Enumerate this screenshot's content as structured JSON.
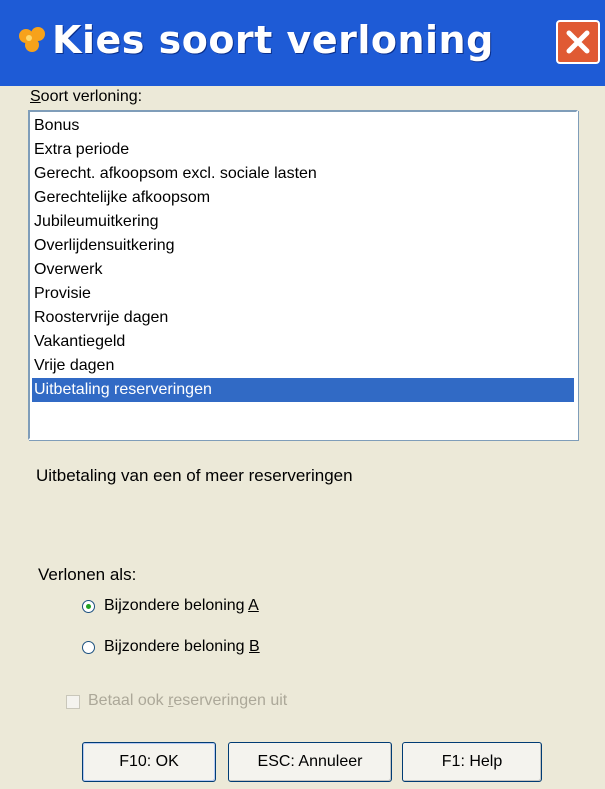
{
  "window": {
    "title": "Kies soort verloning"
  },
  "list": {
    "label_prefix": "S",
    "label_rest": "oort verloning:",
    "items": [
      "Bonus",
      "Extra periode",
      "Gerecht. afkoopsom excl. sociale lasten",
      "Gerechtelijke afkoopsom",
      "Jubileumuitkering",
      "Overlijdensuitkering",
      "Overwerk",
      "Provisie",
      "Roostervrije dagen",
      "Vakantiegeld",
      "Vrije dagen",
      "Uitbetaling reserveringen"
    ],
    "selected_index": 11
  },
  "description": "Uitbetaling van een of meer reserveringen",
  "verlonen": {
    "label": "Verlonen als:",
    "options": [
      {
        "text": "Bijzondere beloning ",
        "accel": "A",
        "checked": true
      },
      {
        "text": "Bijzondere beloning ",
        "accel": "B",
        "checked": false
      }
    ]
  },
  "checkbox": {
    "pre": "Betaal ook ",
    "accel": "r",
    "post": "eserveringen uit",
    "checked": false,
    "enabled": false
  },
  "buttons": {
    "ok": "F10: OK",
    "cancel": "ESC: Annuleer",
    "help": "F1: Help"
  },
  "colors": {
    "titlebar": "#1E5BD6",
    "selection": "#316AC5",
    "close_button": "#E05A33",
    "dialog_bg": "#ECE9D8"
  }
}
